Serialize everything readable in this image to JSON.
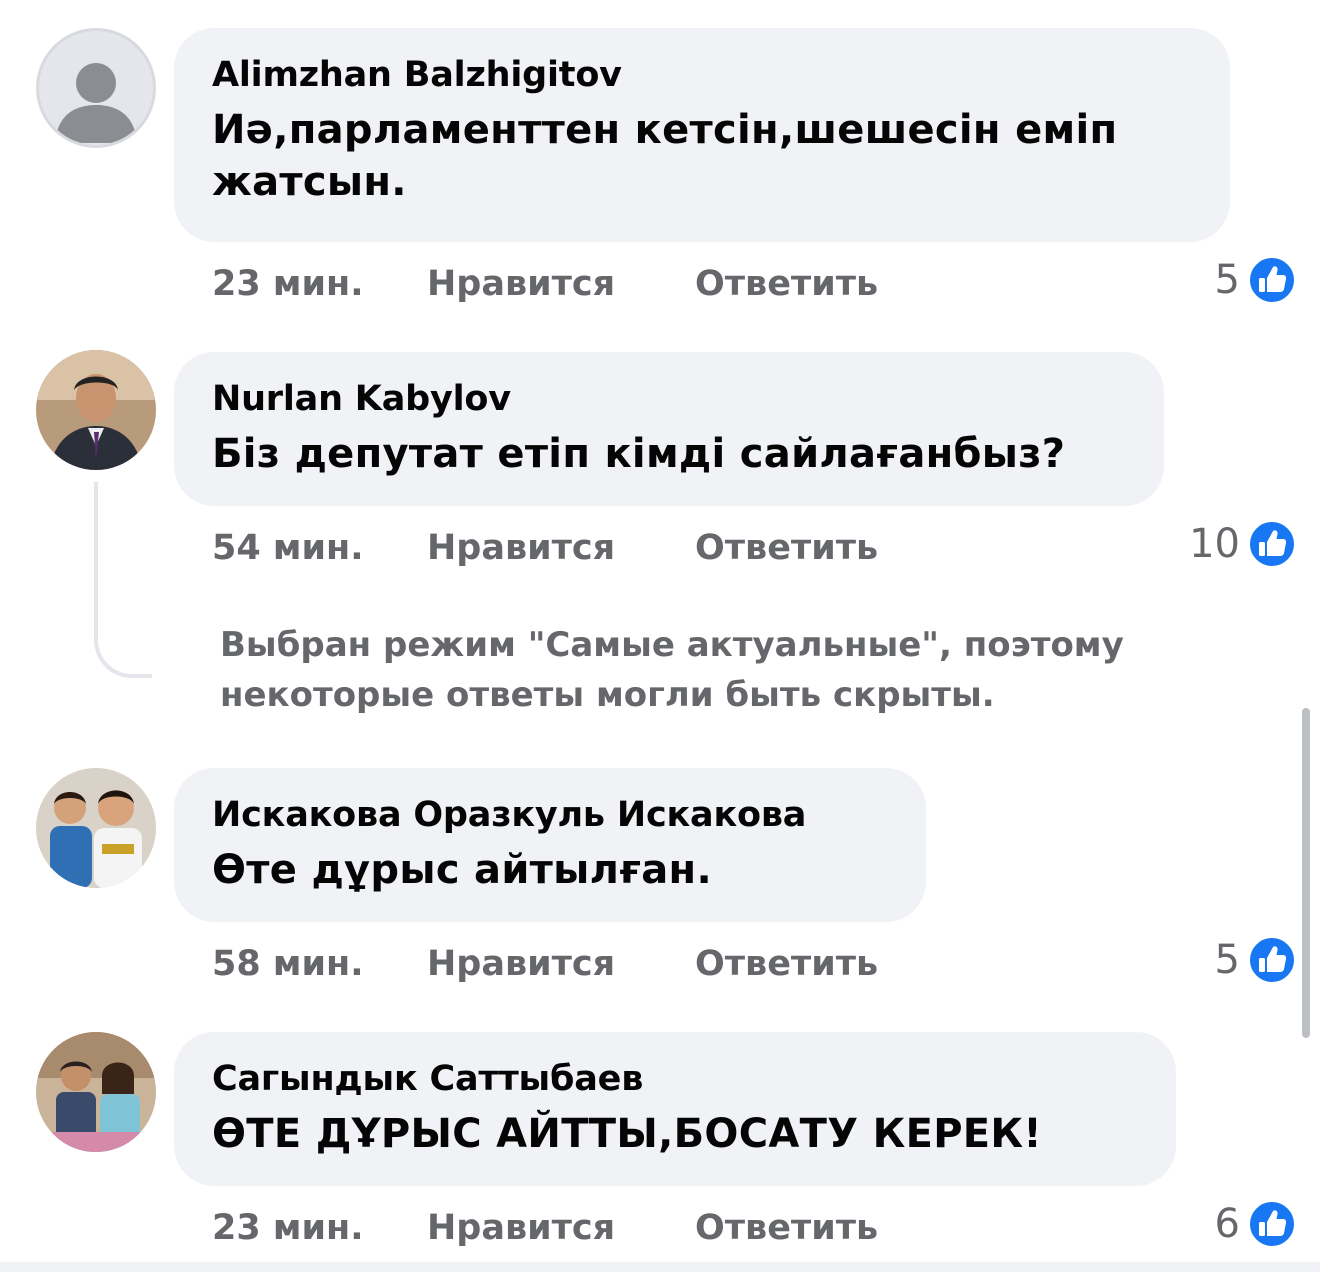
{
  "comments": [
    {
      "author": "Alimzhan Balzhigitov",
      "text": "Иә,парламенттен кетсін,шешесін еміп жатсын.",
      "time": "23 мин.",
      "like_label": "Нравится",
      "reply_label": "Ответить",
      "reactions": "5",
      "avatar_icon": "default-profile-avatar"
    },
    {
      "author": "Nurlan Kabylov",
      "text": "Біз депутат етіп кімді сайлағанбыз?",
      "time": "54 мин.",
      "like_label": "Нравится",
      "reply_label": "Ответить",
      "reactions": "10",
      "avatar_icon": "profile-photo-avatar"
    },
    {
      "author": "Искакова Оразкуль Искакова",
      "text": "Өте дұрыс айтылған.",
      "time": "58 мин.",
      "like_label": "Нравится",
      "reply_label": "Ответить",
      "reactions": "5",
      "avatar_icon": "profile-photo-avatar"
    },
    {
      "author": "Сагындык Саттыбаев",
      "text": "ӨТЕ ДҰРЫС АЙТТЫ,БОСАТУ КЕРЕК!",
      "time": "23 мин.",
      "like_label": "Нравится",
      "reply_label": "Ответить",
      "reactions": "6",
      "avatar_icon": "profile-photo-avatar"
    }
  ],
  "notice": "Выбран режим \"Самые актуальные\", поэтому некоторые ответы могли быть скрыты.",
  "colors": {
    "bubble": "#f0f2f5",
    "meta_text": "#65676b",
    "like_blue": "#1877f2"
  }
}
